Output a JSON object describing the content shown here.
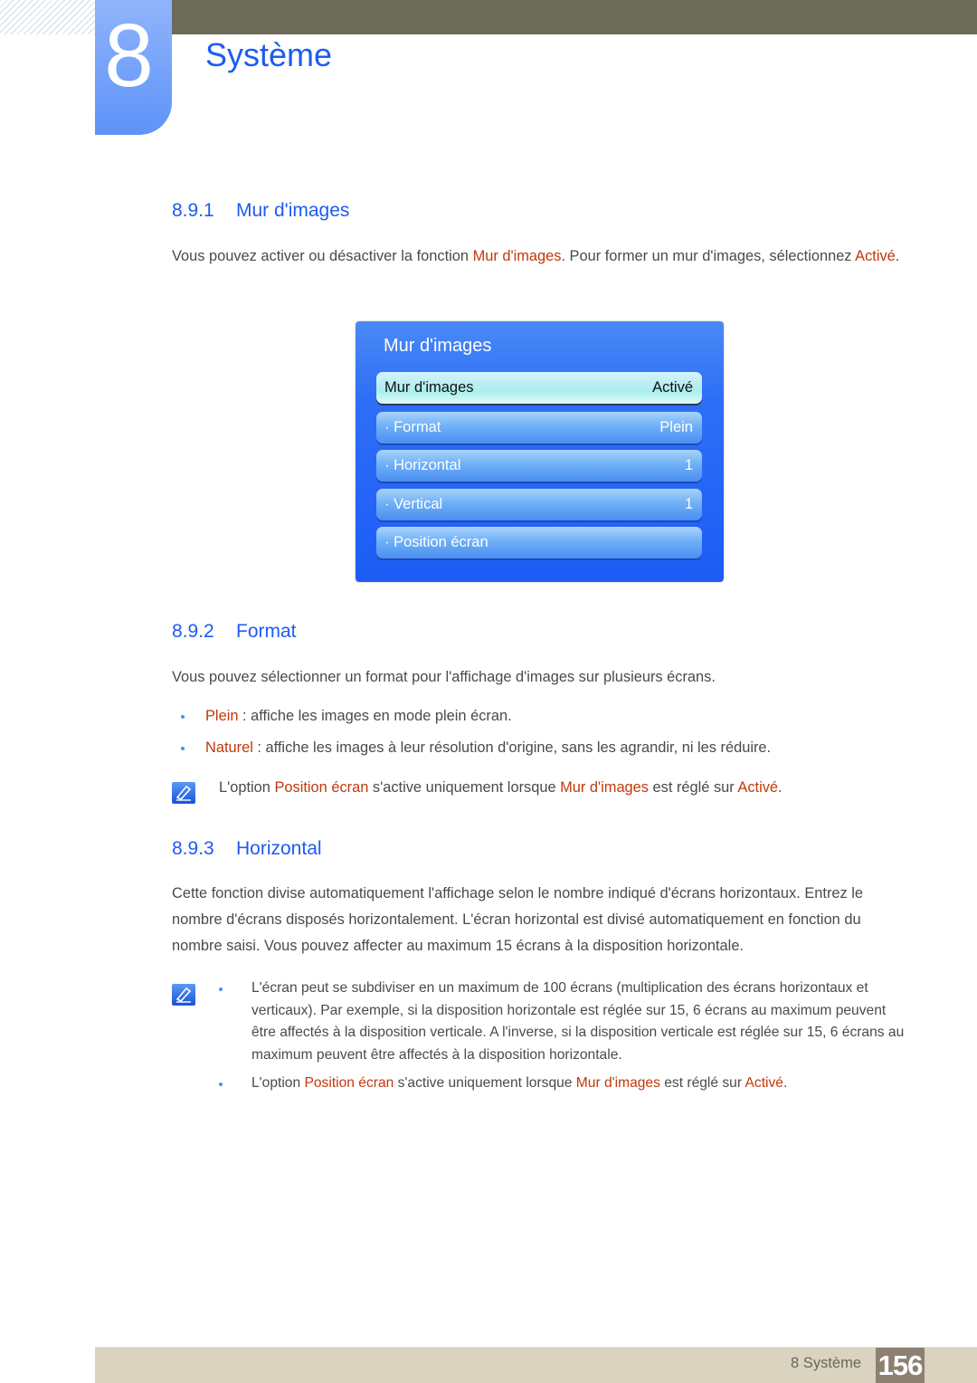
{
  "chapter": {
    "number": "8",
    "title": "Système"
  },
  "sections": [
    {
      "number": "8.9.1",
      "title": "Mur d'images",
      "intro": {
        "part1": "Vous pouvez activer ou désactiver la fonction ",
        "hl1": "Mur d'images",
        "part2": ". Pour former un mur d'images, sélectionnez ",
        "hl2": "Activé",
        "part3": "."
      }
    },
    {
      "number": "8.9.2",
      "title": "Format",
      "intro": "Vous pouvez sélectionner un format pour l'affichage d'images sur plusieurs écrans.",
      "bullets": [
        {
          "term": "Plein",
          "text": " : affiche les images en mode plein écran."
        },
        {
          "term": "Naturel",
          "text": " : affiche les images à leur résolution d'origine, sans les agrandir, ni les réduire."
        }
      ],
      "note": {
        "part1": "L'option ",
        "hl1": "Position écran",
        "part2": " s'active uniquement lorsque ",
        "hl2": "Mur d'images",
        "part3": " est réglé sur ",
        "hl3": "Activé",
        "part4": "."
      }
    },
    {
      "number": "8.9.3",
      "title": "Horizontal",
      "intro": "Cette fonction divise automatiquement l'affichage selon le nombre indiqué d'écrans horizontaux. Entrez le nombre d'écrans disposés horizontalement. L'écran horizontal est divisé automatiquement en fonction du nombre saisi. Vous pouvez affecter au maximum 15 écrans à la disposition horizontale.",
      "notes": [
        {
          "text": "L'écran peut se subdiviser en un maximum de 100 écrans (multiplication des écrans horizontaux et verticaux). Par exemple, si la disposition horizontale est réglée sur 15, 6 écrans au maximum peuvent être affectés à la disposition verticale. A l'inverse, si la disposition verticale est réglée sur 15, 6 écrans au maximum peuvent être affectés à la disposition horizontale."
        },
        {
          "part1": "L'option ",
          "hl1": "Position écran",
          "part2": " s'active uniquement lorsque ",
          "hl2": "Mur d'images",
          "part3": " est réglé sur ",
          "hl3": "Activé",
          "part4": "."
        }
      ]
    }
  ],
  "osd_menu": {
    "title": "Mur d'images",
    "items": [
      {
        "label": "Mur d'images",
        "value": "Activé",
        "selected": true
      },
      {
        "label": "· Format",
        "value": "Plein"
      },
      {
        "label": "· Horizontal",
        "value": "1"
      },
      {
        "label": "· Vertical",
        "value": "1"
      },
      {
        "label": "· Position écran",
        "value": ""
      }
    ]
  },
  "icons": {
    "note": "note-pencil-icon"
  },
  "footer": {
    "label": "8 Système",
    "page_number": "156"
  }
}
